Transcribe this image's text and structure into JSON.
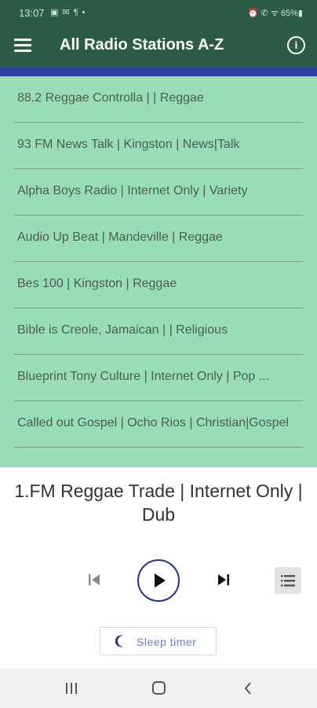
{
  "status_bar": {
    "time": "13:07",
    "notifications": "▣ ✉ ¶ •",
    "system": "⏰ ✆ ᯤ 65%▮"
  },
  "app_bar": {
    "title": "All Radio Stations A-Z",
    "menu_icon": "hamburger-menu",
    "info_icon": "info-circle",
    "info_glyph": "i"
  },
  "stations": [
    {
      "label": "1.FM Reggae Trade | Internet Only | Dub",
      "active": true
    },
    {
      "label": "88.2 Reggae Controlla | | Reggae",
      "active": false
    },
    {
      "label": "93 FM News Talk | Kingston | News|Talk",
      "active": false
    },
    {
      "label": "Alpha Boys Radio | Internet Only | Variety",
      "active": false
    },
    {
      "label": "Audio Up Beat | Mandeville | Reggae",
      "active": false
    },
    {
      "label": "Bes 100 | Kingston | Reggae",
      "active": false
    },
    {
      "label": "Bible is Creole, Jamaican | | Religious",
      "active": false
    },
    {
      "label": "Blueprint Tony Culture | Internet Only | Pop ...",
      "active": false
    },
    {
      "label": "Called out Gospel | Ocho Rios | Christian|Gospel",
      "active": false
    }
  ],
  "player": {
    "now_playing_line1": "1.FM Reggae Trade | Internet Only |",
    "now_playing_line2": "Dub",
    "sleep_timer_label": "Sleep timer"
  },
  "colors": {
    "app_bar": "#2c5b46",
    "list_background": "#98ddb8",
    "active_row": "#2a3f9c",
    "play_ring": "#23318a",
    "sleep_text": "#6a7dbd"
  }
}
